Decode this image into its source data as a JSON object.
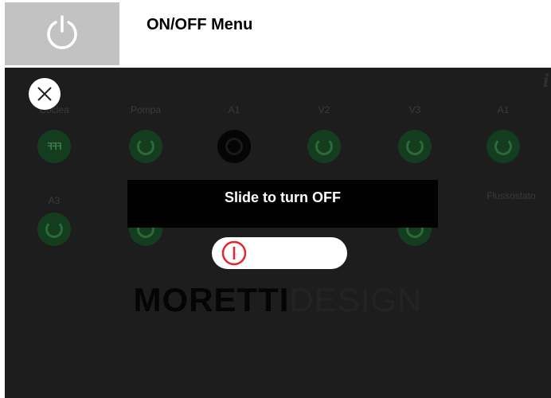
{
  "header": {
    "title": "ON/OFF Menu",
    "icon": "power-icon"
  },
  "screen": {
    "status_text": "",
    "info_icon_glyph": "i",
    "devices_row1": [
      {
        "label": "Coclea"
      },
      {
        "label": "Pompa"
      },
      {
        "label": "A1"
      },
      {
        "label": "V2"
      },
      {
        "label": "V3"
      },
      {
        "label": "A1"
      }
    ],
    "devices_row2": [
      {
        "label": "A3"
      },
      {
        "label": ""
      },
      {
        "label": ""
      },
      {
        "label": ""
      },
      {
        "label": ""
      },
      {
        "label": "Flussostato"
      }
    ],
    "logo_bold": "MORETTI",
    "logo_light": "DESIGN"
  },
  "dialog": {
    "message": "Slide to turn OFF",
    "slider_position": 0
  },
  "colors": {
    "power_red": "#e8232a",
    "device_green": "#143c1e"
  }
}
